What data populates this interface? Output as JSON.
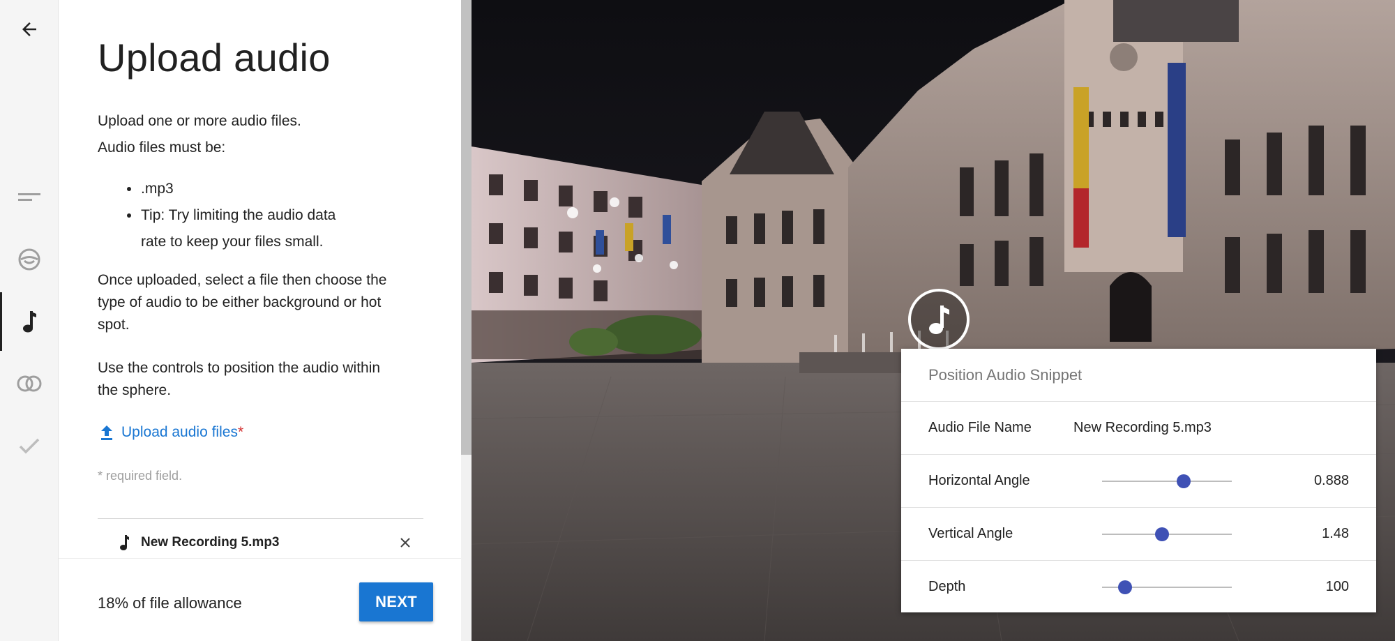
{
  "panel": {
    "title": "Upload audio",
    "intro_line1": "Upload one or more audio files.",
    "intro_line2": "Audio files must be:",
    "requirements": [
      ".mp3",
      "Tip: Try limiting the audio data rate to keep your files small."
    ],
    "paragraph1": "Once uploaded, select a file then choose the type of audio to be either background or hot spot.",
    "paragraph2": "Use the controls to position the audio within the sphere.",
    "upload_label": "Upload audio files",
    "required_star": "*",
    "required_note": "* required field.",
    "files": [
      {
        "name": "New Recording 5.mp3"
      }
    ],
    "allowance": "18% of file allowance",
    "next_label": "NEXT"
  },
  "rail": {
    "icons": [
      "back-arrow-icon",
      "details-icon",
      "vr-headset-icon",
      "music-note-icon",
      "link-rings-icon",
      "checkmark-icon"
    ],
    "active": "music-note-icon"
  },
  "card": {
    "title": "Position Audio Snippet",
    "file_label": "Audio File Name",
    "file_value": "New Recording 5.mp3",
    "horizontal_label": "Horizontal Angle",
    "horizontal_value": "0.888",
    "horizontal_fraction": 0.63,
    "vertical_label": "Vertical Angle",
    "vertical_value": "1.48",
    "vertical_fraction": 0.46,
    "depth_label": "Depth",
    "depth_value": "100",
    "depth_fraction": 0.18
  },
  "colors": {
    "accent": "#1976d2",
    "slider_knob": "#3f51b5",
    "required": "#d32f2f"
  }
}
